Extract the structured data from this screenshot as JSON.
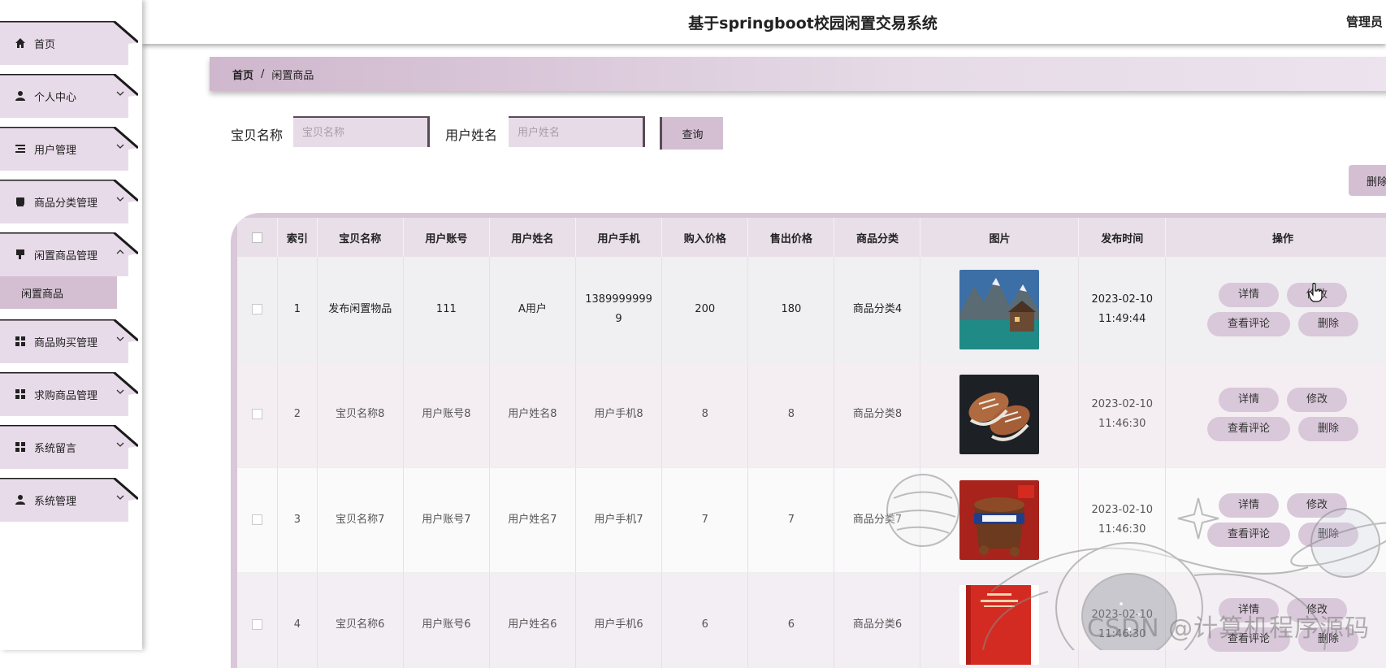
{
  "header": {
    "title": "基于springboot校园闲置交易系统",
    "user": "管理员"
  },
  "sidebar": {
    "items": [
      {
        "label": "首页",
        "icon": "home-icon"
      },
      {
        "label": "个人中心",
        "icon": "user-icon"
      },
      {
        "label": "用户管理",
        "icon": "list-icon"
      },
      {
        "label": "商品分类管理",
        "icon": "tag-icon"
      },
      {
        "label": "闲置商品管理",
        "icon": "flag-icon"
      },
      {
        "label": "商品购买管理",
        "icon": "grid-icon"
      },
      {
        "label": "求购商品管理",
        "icon": "grid-icon"
      },
      {
        "label": "系统留言",
        "icon": "grid-icon"
      },
      {
        "label": "系统管理",
        "icon": "user-icon"
      }
    ],
    "active_sub_item": "闲置商品"
  },
  "breadcrumb": {
    "home": "首页",
    "separator": "/",
    "current": "闲置商品"
  },
  "search": {
    "name_label": "宝贝名称",
    "name_placeholder": "宝贝名称",
    "user_label": "用户姓名",
    "user_placeholder": "用户姓名",
    "query_button": "查询"
  },
  "toolbar": {
    "delete_label": "删除"
  },
  "table": {
    "columns": [
      "索引",
      "宝贝名称",
      "用户账号",
      "用户姓名",
      "用户手机",
      "购入价格",
      "售出价格",
      "商品分类",
      "图片",
      "发布时间",
      "操作"
    ],
    "rows": [
      {
        "index": "1",
        "name": "发布闲置物品",
        "account": "111",
        "username": "A用户",
        "phone": "13899999999",
        "buy": "200",
        "sell": "180",
        "category": "商品分类4",
        "image": "mountain-lake-photo",
        "date": "2023-02-10",
        "time": "11:49:44"
      },
      {
        "index": "2",
        "name": "宝贝名称8",
        "account": "用户账号8",
        "username": "用户姓名8",
        "phone": "用户手机8",
        "buy": "8",
        "sell": "8",
        "category": "商品分类8",
        "image": "shoes-photo",
        "date": "2023-02-10",
        "time": "11:46:30"
      },
      {
        "index": "3",
        "name": "宝贝名称7",
        "account": "用户账号7",
        "username": "用户姓名7",
        "phone": "用户手机7",
        "buy": "7",
        "sell": "7",
        "category": "商品分类7",
        "image": "snickers-tub-photo",
        "date": "2023-02-10",
        "time": "11:46:30"
      },
      {
        "index": "4",
        "name": "宝贝名称6",
        "account": "用户账号6",
        "username": "用户姓名6",
        "phone": "用户手机6",
        "buy": "6",
        "sell": "6",
        "category": "商品分类6",
        "image": "red-book-photo",
        "date": "2023-02-10",
        "time": "11:46:30"
      }
    ],
    "actions": {
      "detail": "详情",
      "edit": "修改",
      "comments": "查看评论",
      "delete": "删除"
    }
  },
  "watermark": "CSDN @计算机程序源码",
  "colors": {
    "accent": "#d4bfd2",
    "header_bg": "#e9dfe9",
    "table_frame": "#d9c8d9"
  }
}
